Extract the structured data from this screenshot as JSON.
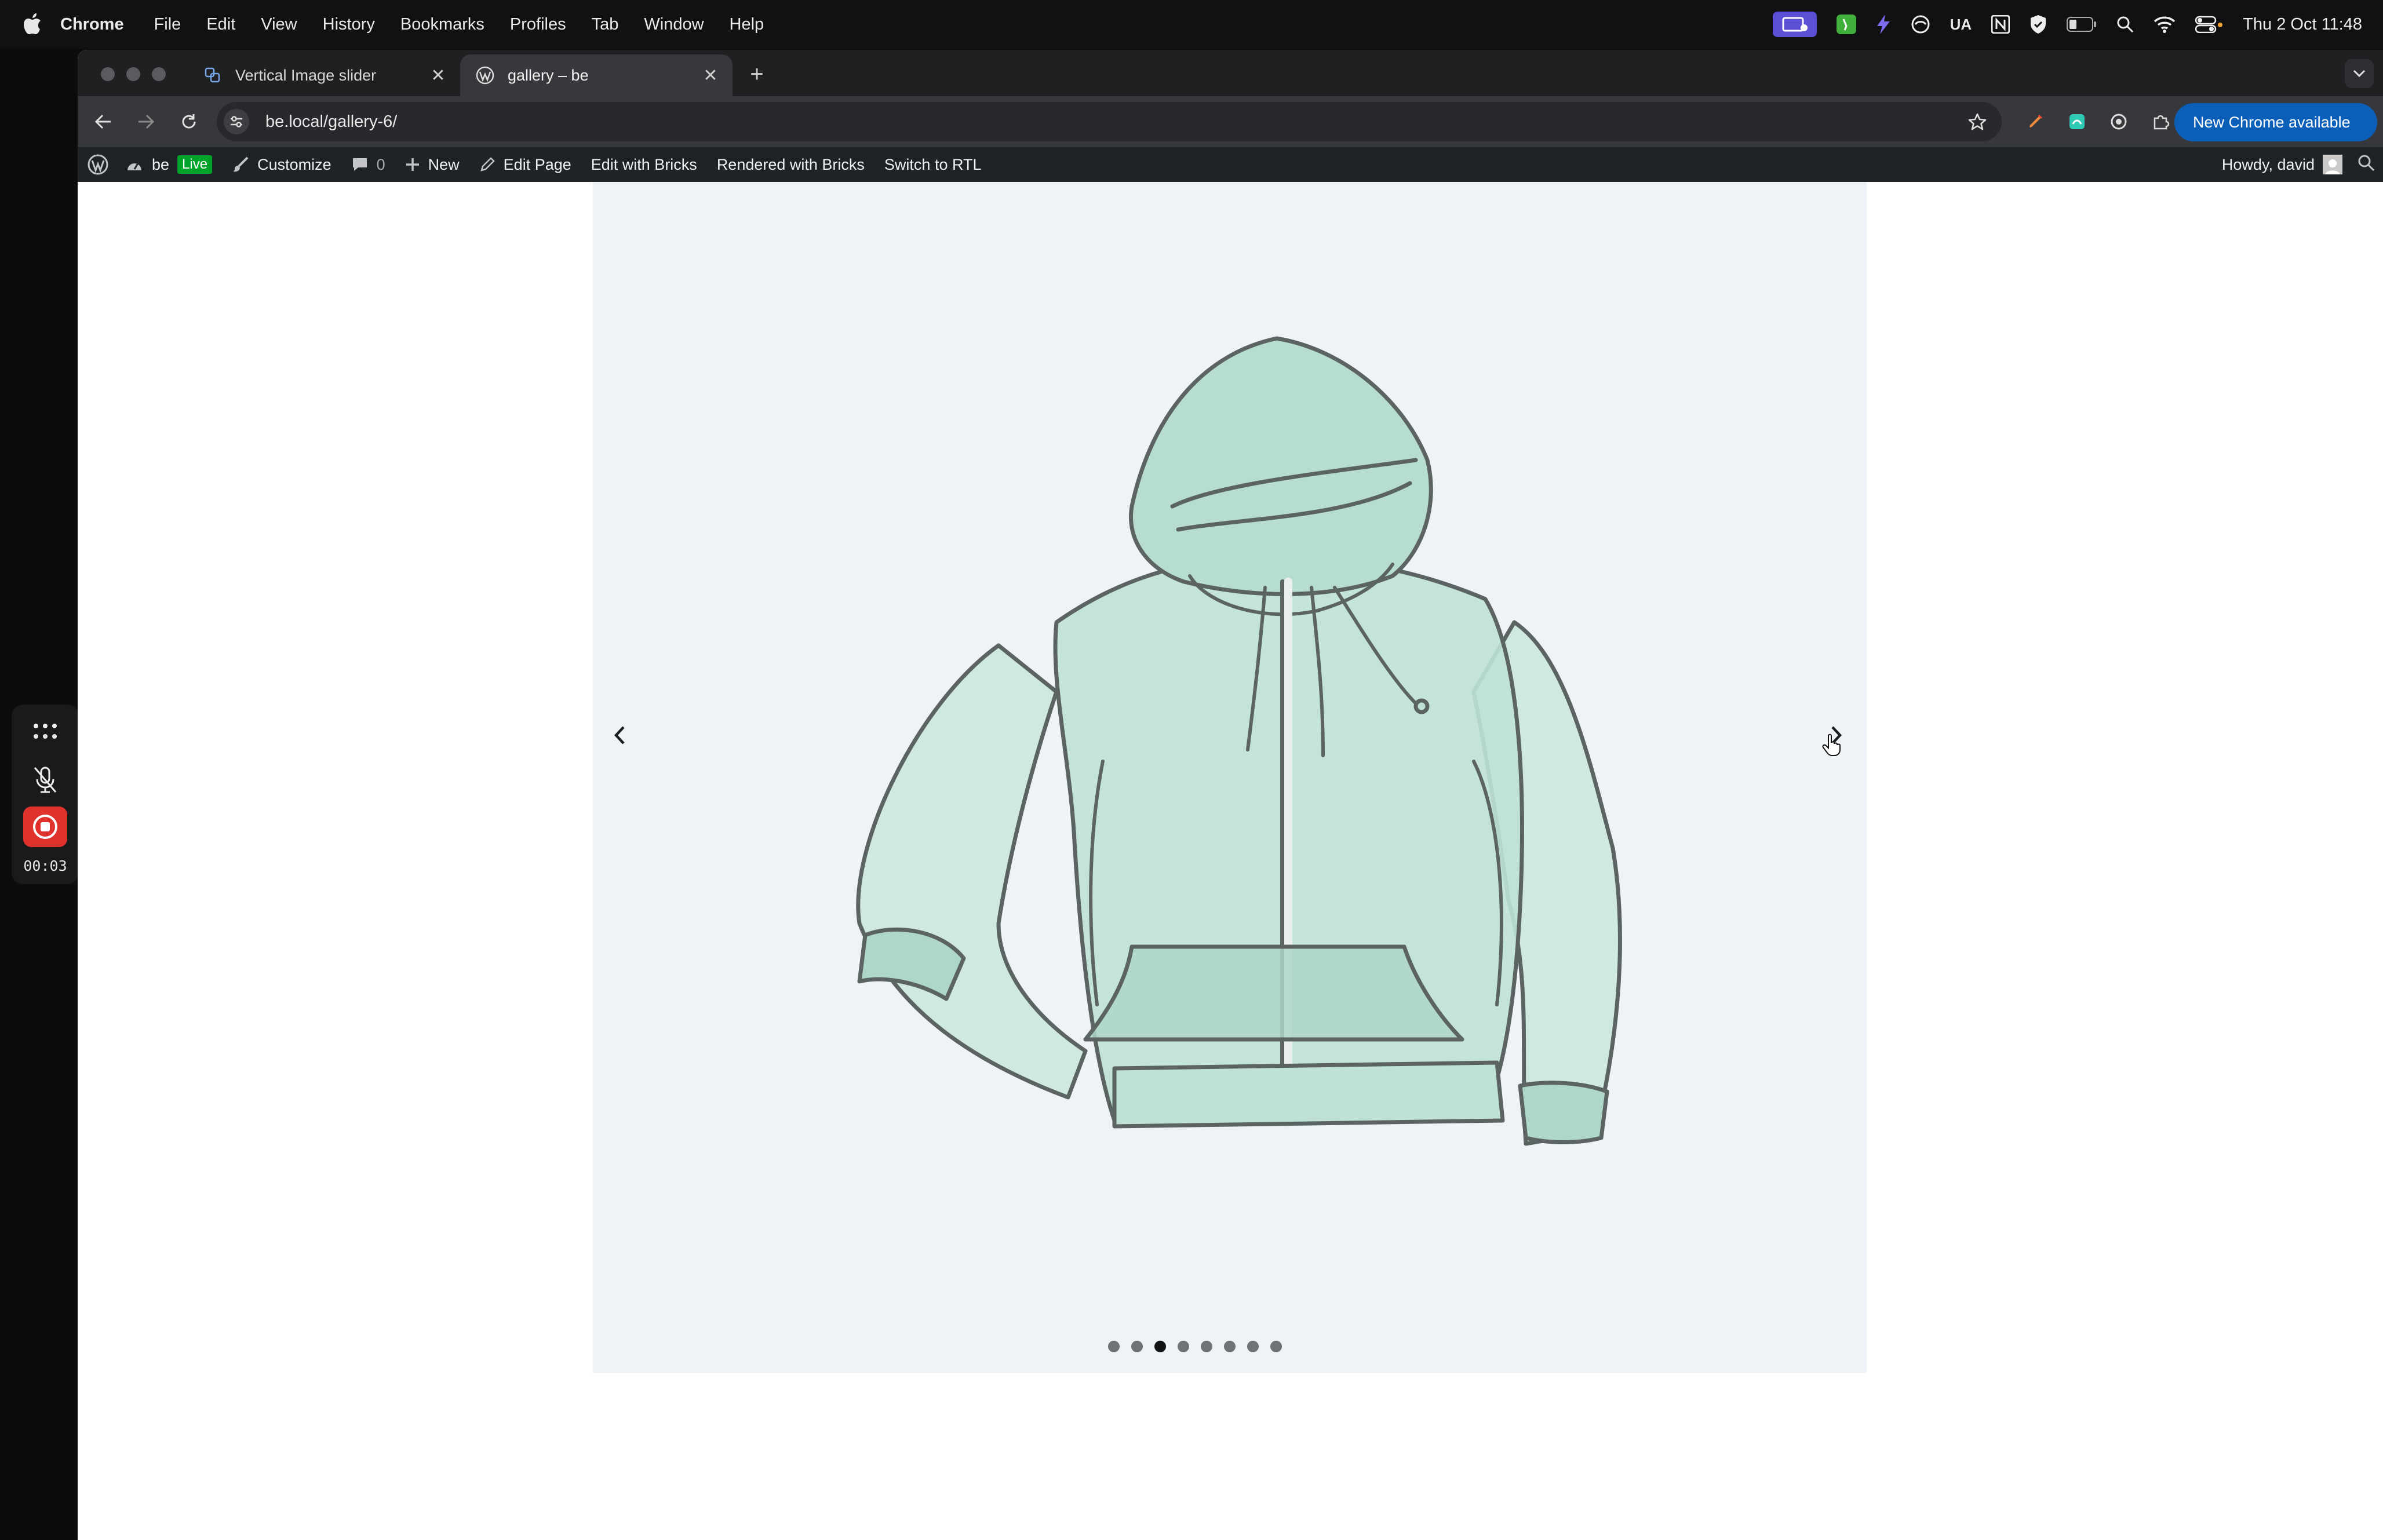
{
  "menubar": {
    "app": "Chrome",
    "items": [
      "File",
      "Edit",
      "View",
      "History",
      "Bookmarks",
      "Profiles",
      "Tab",
      "Window",
      "Help"
    ],
    "status_icons": [
      "screen-share-icon",
      "app-icon",
      "bolt-icon",
      "swirl-icon",
      "ua-text",
      "notion-icon",
      "shield-icon",
      "battery-icon",
      "spotlight-search-icon",
      "wifi-icon",
      "control-center-icon"
    ],
    "ua_label": "UA",
    "clock": "Thu 2 Oct  11:48"
  },
  "browser": {
    "tabs": [
      {
        "title": "Vertical Image slider",
        "icon": "bricks-favicon-icon",
        "active": false
      },
      {
        "title": "gallery – be",
        "icon": "wordpress-favicon-icon",
        "active": true
      }
    ],
    "url": "be.local/gallery-6/",
    "update_button": "New Chrome available"
  },
  "adminbar": {
    "site_name": "be",
    "live_badge": "Live",
    "customize": "Customize",
    "comments_count": "0",
    "new": "New",
    "edit_page": "Edit Page",
    "edit_bricks": "Edit with Bricks",
    "rendered": "Rendered with Bricks",
    "rtl": "Switch to RTL",
    "howdy": "Howdy, david"
  },
  "slider": {
    "total_slides": 8,
    "active_index": 2,
    "image_alt": "Watercolor sketch of a mint-green hooded zip sweatshirt",
    "accent_color": "#b7ddd1"
  },
  "recorder": {
    "time": "00:03",
    "record_color": "#e0322c"
  }
}
